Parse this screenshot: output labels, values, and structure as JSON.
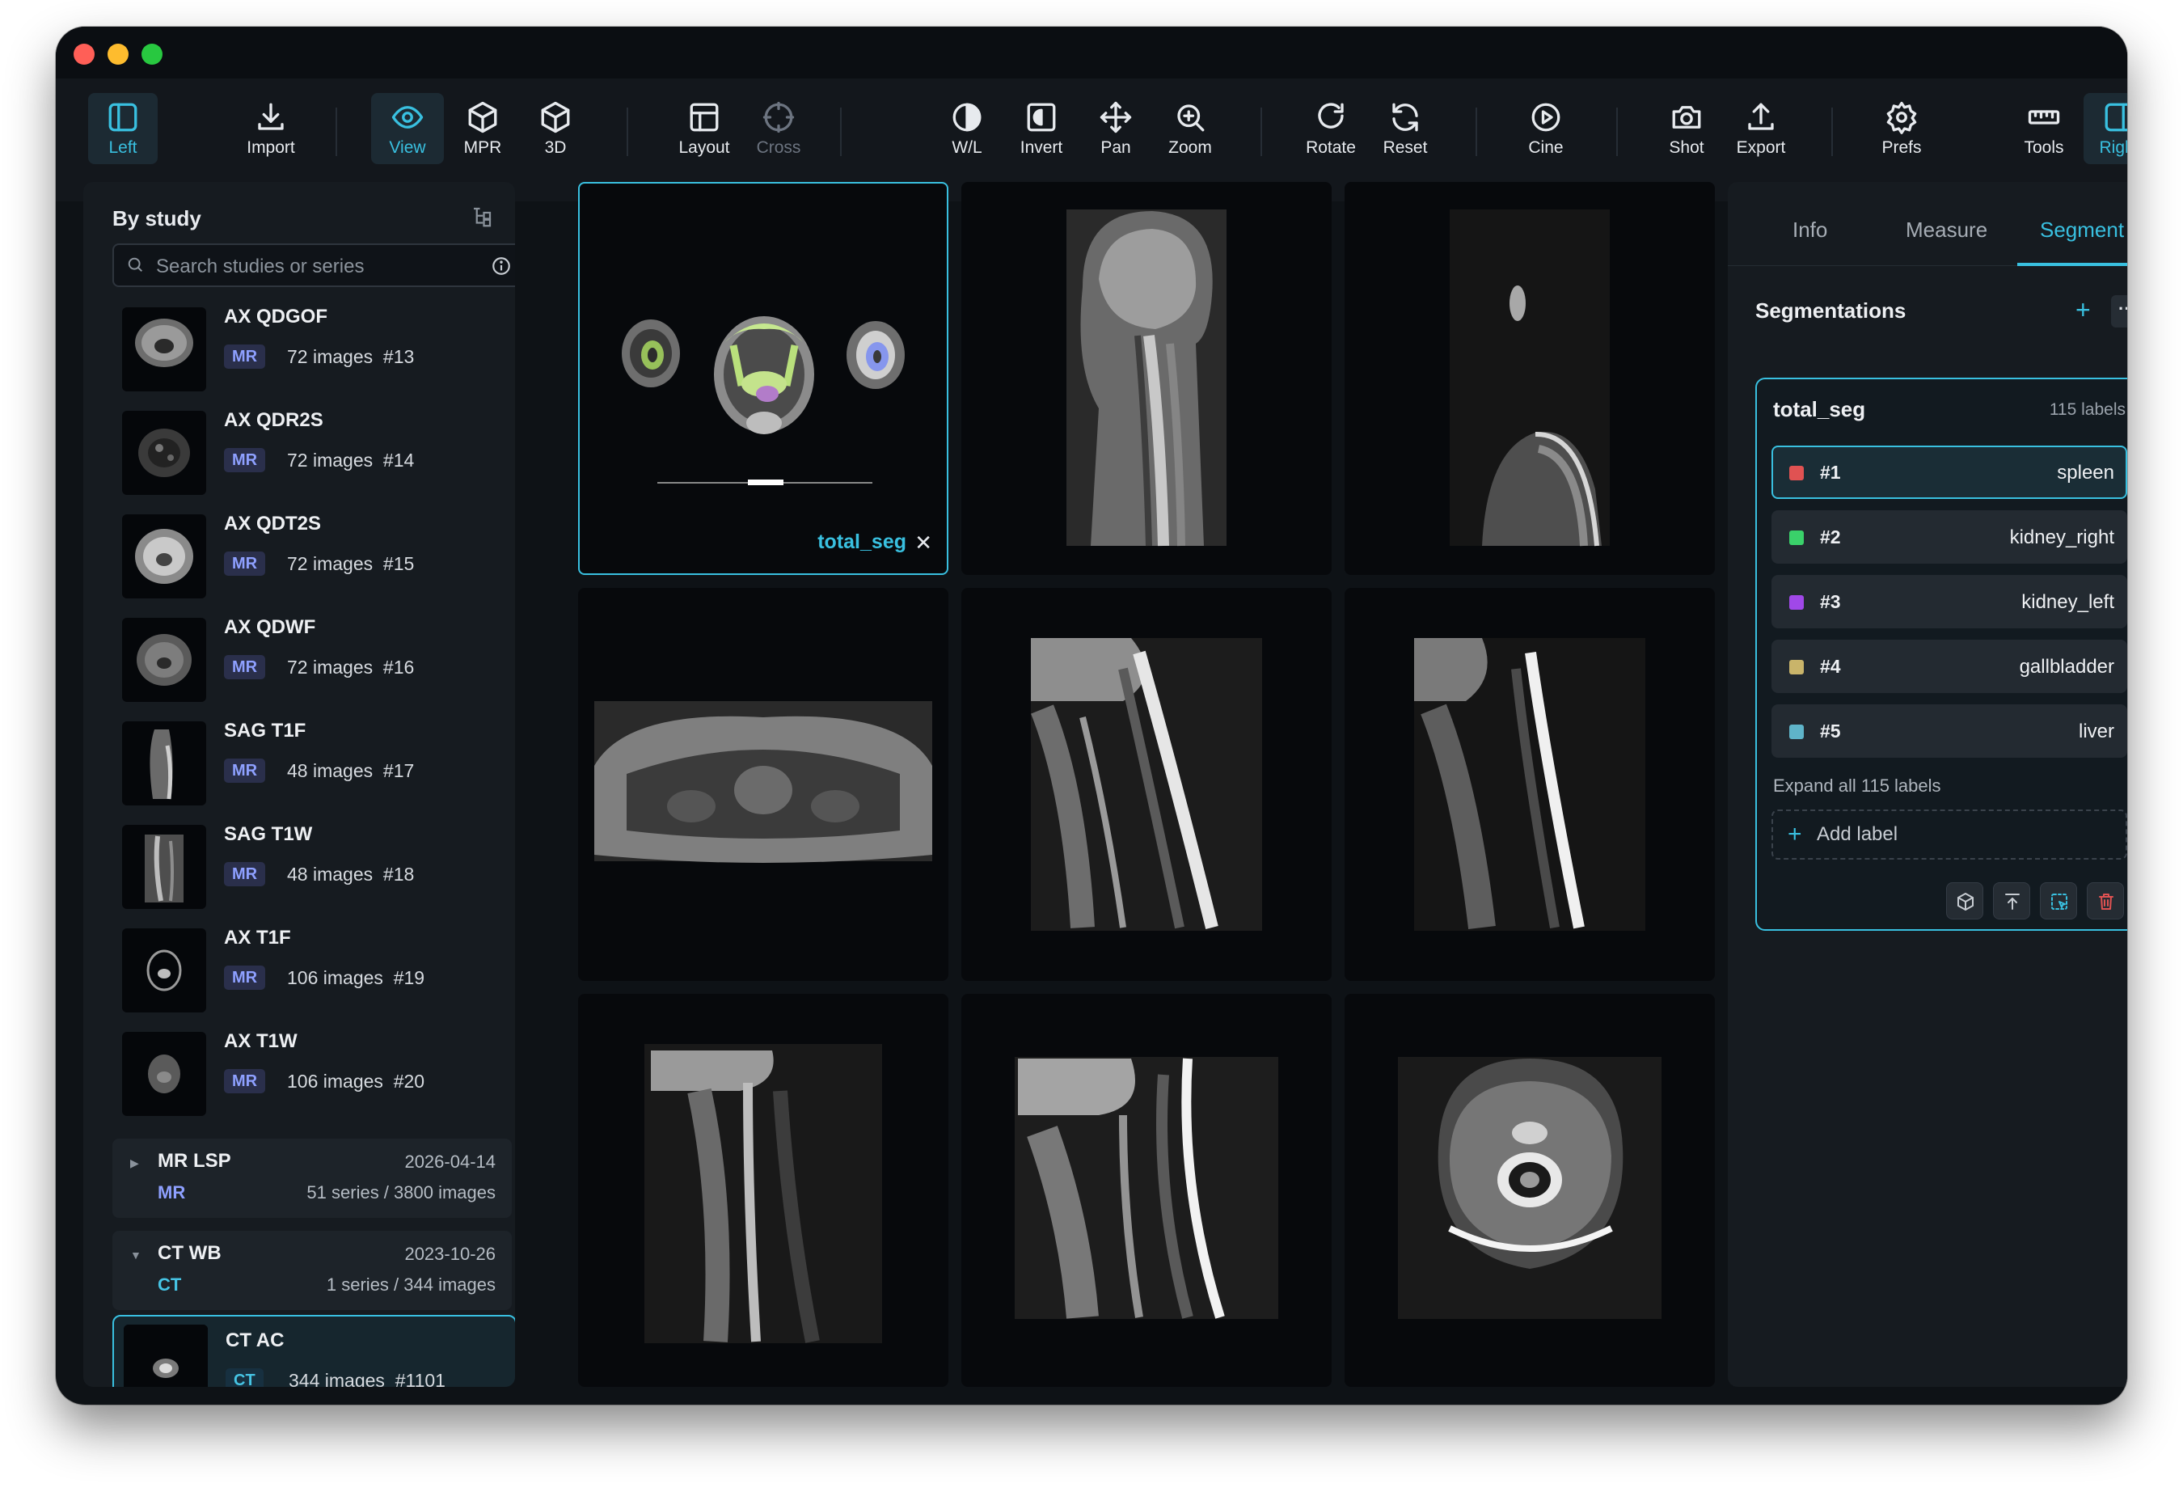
{
  "toolbar": {
    "left": "Left",
    "import": "Import",
    "view": "View",
    "mpr": "MPR",
    "three_d": "3D",
    "layout": "Layout",
    "cross": "Cross",
    "wl": "W/L",
    "invert": "Invert",
    "pan": "Pan",
    "zoom": "Zoom",
    "rotate": "Rotate",
    "reset": "Reset",
    "cine": "Cine",
    "shot": "Shot",
    "export": "Export",
    "prefs": "Prefs",
    "tools": "Tools",
    "right": "Right"
  },
  "sidebar": {
    "title": "By study",
    "search_placeholder": "Search studies or series",
    "series": [
      {
        "name": "AX QDGOF",
        "modality": "MR",
        "count": "72 images",
        "number": "#13"
      },
      {
        "name": "AX QDR2S",
        "modality": "MR",
        "count": "72 images",
        "number": "#14"
      },
      {
        "name": "AX QDT2S",
        "modality": "MR",
        "count": "72 images",
        "number": "#15"
      },
      {
        "name": "AX QDWF",
        "modality": "MR",
        "count": "72 images",
        "number": "#16"
      },
      {
        "name": "SAG T1F",
        "modality": "MR",
        "count": "48 images",
        "number": "#17"
      },
      {
        "name": "SAG T1W",
        "modality": "MR",
        "count": "48 images",
        "number": "#18"
      },
      {
        "name": "AX T1F",
        "modality": "MR",
        "count": "106 images",
        "number": "#19"
      },
      {
        "name": "AX T1W",
        "modality": "MR",
        "count": "106 images",
        "number": "#20"
      }
    ],
    "studies": [
      {
        "name": "MR LSP",
        "date": "2026-04-14",
        "modality": "MR",
        "summary": "51 series / 3800 images"
      },
      {
        "name": "CT WB",
        "date": "2023-10-26",
        "modality": "CT",
        "summary": "1 series / 344 images"
      }
    ],
    "selected_series": {
      "name": "CT AC",
      "modality": "CT",
      "count": "344 images",
      "number": "#1101"
    }
  },
  "viewport": {
    "overlay_label": "total_seg",
    "close": "✕"
  },
  "panel": {
    "tabs": [
      "Info",
      "Measure",
      "Segment"
    ],
    "active_tab": "Segment",
    "section_title": "Segmentations",
    "add": "+",
    "more": "···",
    "segmentation": {
      "name": "total_seg",
      "count": "115 labels",
      "labels": [
        {
          "num": "#1",
          "name": "spleen",
          "color": "#e05252"
        },
        {
          "num": "#2",
          "name": "kidney_right",
          "color": "#3ad16a"
        },
        {
          "num": "#3",
          "name": "kidney_left",
          "color": "#a048e8"
        },
        {
          "num": "#4",
          "name": "gallbladder",
          "color": "#c9b46a"
        },
        {
          "num": "#5",
          "name": "liver",
          "color": "#5fb4c9"
        }
      ],
      "expand": "Expand all 115 labels",
      "add_label": "Add label"
    }
  },
  "colors": {
    "accent": "#39c0e0",
    "bg": "#0e1216",
    "panel": "#161b20",
    "mr": "#8ea0ff",
    "ct": "#46c4e4"
  }
}
